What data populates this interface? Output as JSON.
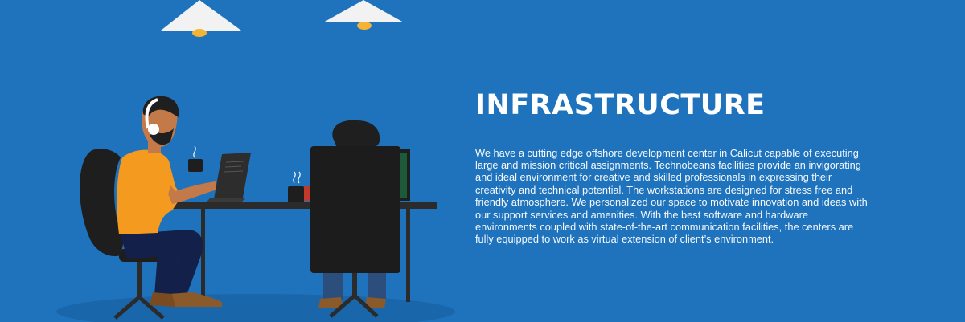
{
  "section": {
    "title": "INFRASTRUCTURE",
    "body": "We have a cutting edge offshore development center in Calicut capable of executing large and mission critical assignments. Technobeans facilities provide an invigorating and ideal environment for creative and skilled professionals in expressing their creativity and technical potential. The workstations are designed for stress free and friendly atmosphere. We personalized our space to motivate innovation and ideas with our support services and amenities. With the best software and hardware environments coupled with state-of-the-art communication facilities, the centers are fully equipped to work as virtual extension of client’s environment."
  },
  "colors": {
    "background": "#1f73bd",
    "floor_shadow": "#1a66ab",
    "shirt": "#f39a1f",
    "pants": "#13204a",
    "chair": "#1e1e1e",
    "lamp": "#f2f2f2",
    "bulb": "#f5b335"
  },
  "illustration": {
    "icons": [
      "pendant-lamp-icon",
      "worker-with-headphones-icon",
      "laptop-icon",
      "coffee-mug-icon",
      "office-chair-icon",
      "desk-icon",
      "monitor-icon"
    ]
  }
}
